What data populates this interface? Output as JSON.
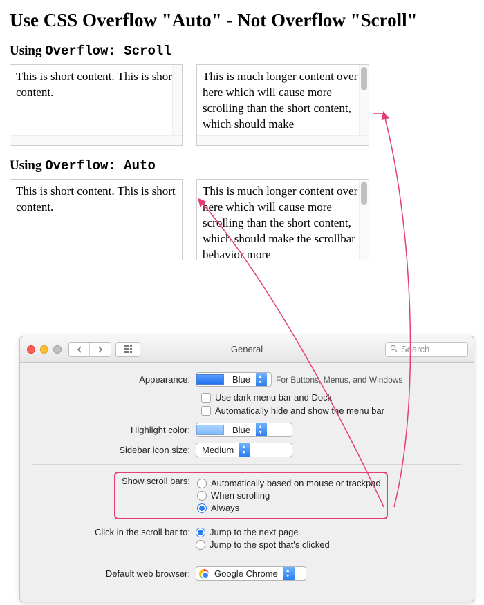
{
  "title": "Use CSS Overflow \"Auto\" - Not Overflow \"Scroll\"",
  "sections": {
    "scroll": {
      "prefix": "Using ",
      "mono": "Overflow: Scroll"
    },
    "auto": {
      "prefix": "Using ",
      "mono": "Overflow: Auto"
    }
  },
  "demo": {
    "short_line1": "This is short content.",
    "short_line2": "This is short content.",
    "long_scroll": "This is much longer content over here which will cause more scrolling than the short content, which should make",
    "long_auto": "This is much longer content over here which will cause more scrolling than the short content, which should make the scrollbar behavior more"
  },
  "prefs": {
    "window_title": "General",
    "search_placeholder": "Search",
    "appearance": {
      "label": "Appearance:",
      "value": "Blue",
      "help": "For Buttons, Menus, and Windows"
    },
    "dark_menu": "Use dark menu bar and Dock",
    "auto_hide": "Automatically hide and show the menu bar",
    "highlight": {
      "label": "Highlight color:",
      "value": "Blue"
    },
    "sidebar": {
      "label": "Sidebar icon size:",
      "value": "Medium"
    },
    "scrollbars": {
      "label": "Show scroll bars:",
      "opt1": "Automatically based on mouse or trackpad",
      "opt2": "When scrolling",
      "opt3": "Always"
    },
    "click_sb": {
      "label": "Click in the scroll bar to:",
      "opt1": "Jump to the next page",
      "opt2": "Jump to the spot that's clicked"
    },
    "browser": {
      "label": "Default web browser:",
      "value": "Google Chrome"
    }
  }
}
